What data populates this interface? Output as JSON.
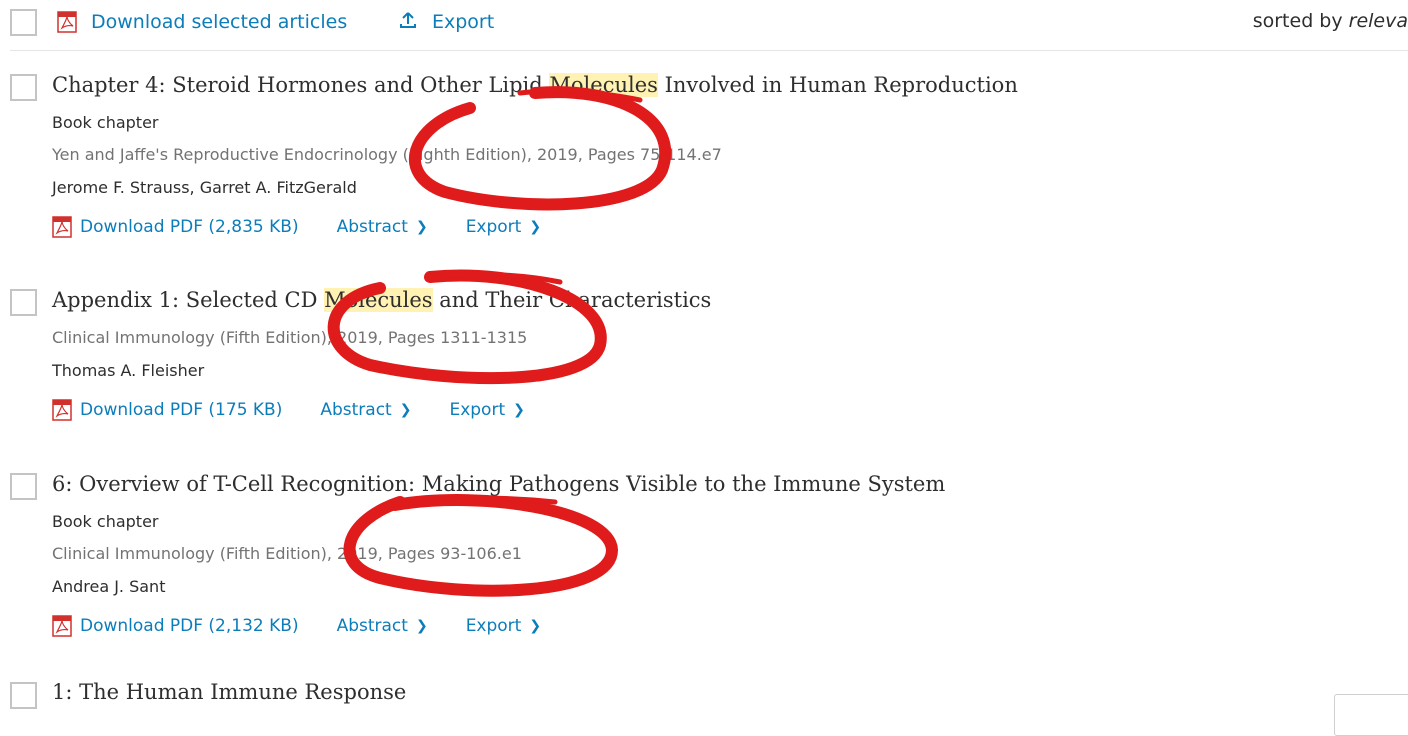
{
  "toolbar": {
    "download_label": "Download selected articles",
    "export_label": "Export",
    "sorted_prefix": "sorted by ",
    "sorted_value": "releva"
  },
  "articles": [
    {
      "title_before": "Chapter 4: Steroid Hormones and Other Lipid ",
      "title_highlight": "Molecules",
      "title_after": " Involved in Human Reproduction",
      "type": "Book chapter",
      "source": "Yen and Jaffe's Reproductive Endocrinology (Eighth Edition), 2019, Pages 75-114.e7",
      "authors": "Jerome F. Strauss, Garret A. FitzGerald",
      "download": "Download PDF (2,835 KB)",
      "abstract": "Abstract",
      "export": "Export"
    },
    {
      "title_before": "Appendix 1: Selected CD ",
      "title_highlight": "Molecules",
      "title_after": " and Their Characteristics",
      "type": "",
      "source": "Clinical Immunology (Fifth Edition), 2019, Pages 1311-1315",
      "authors": "Thomas A. Fleisher",
      "download": "Download PDF (175 KB)",
      "abstract": "Abstract",
      "export": "Export"
    },
    {
      "title_before": "6: Overview of T-Cell Recognition: Making Pathogens Visible to the Immune System",
      "title_highlight": "",
      "title_after": "",
      "type": "Book chapter",
      "source": "Clinical Immunology (Fifth Edition), 2019, Pages 93-106.e1",
      "authors": "Andrea J. Sant",
      "download": "Download PDF (2,132 KB)",
      "abstract": "Abstract",
      "export": "Export"
    },
    {
      "title_before": "1: The Human Immune Response",
      "title_highlight": "",
      "title_after": ""
    }
  ],
  "colors": {
    "link": "#0c7dbb",
    "highlight": "#fff2b3",
    "annotation": "#e01b1b"
  },
  "icons": [
    "pdf-icon",
    "export-upload-icon",
    "chevron-down-icon"
  ]
}
